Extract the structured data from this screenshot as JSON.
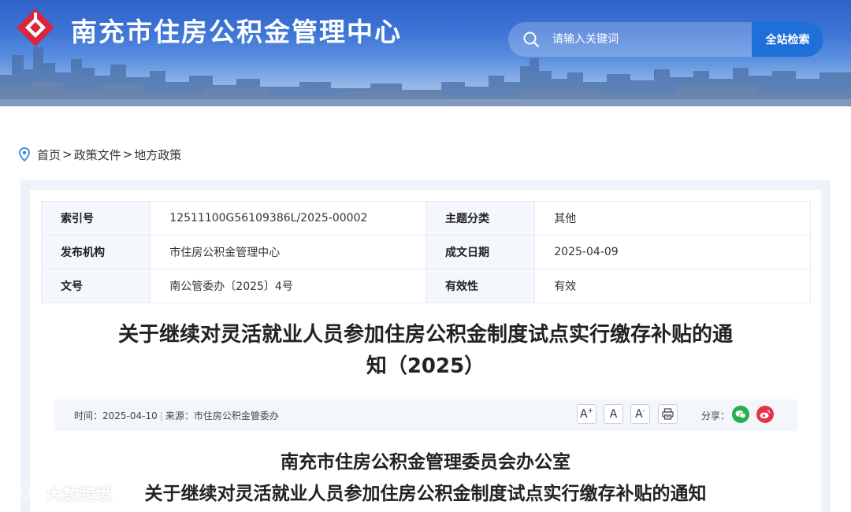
{
  "header": {
    "site_title": "南充市住房公积金管理中心",
    "search_placeholder": "请输入关键词",
    "search_button": "全站检索",
    "logo_icon": "red-diamond-logo-icon"
  },
  "breadcrumb": {
    "icon": "location-pin-icon",
    "items": [
      "首页",
      "政策文件",
      "地方政策"
    ],
    "separator": ">"
  },
  "info_table": {
    "rows": [
      {
        "label1": "索引号",
        "value1": "12511100G56109386L/2025-00002",
        "label2": "主题分类",
        "value2": "其他"
      },
      {
        "label1": "发布机构",
        "value1": "市住房公积金管理中心",
        "label2": "成文日期",
        "value2": "2025-04-09"
      },
      {
        "label1": "文号",
        "value1": "南公管委办〔2025〕4号",
        "label2": "有效性",
        "value2": "有效"
      }
    ]
  },
  "article": {
    "title_line1": "关于继续对灵活就业人员参加住房公积金制度试点实行缴存补贴的通",
    "title_line2": "知（2025）",
    "meta_time_label": "时间：",
    "meta_time": "2025-04-10",
    "meta_source_label": "来源：",
    "meta_source": "市住房公积金管委办",
    "meta_sep": "|",
    "share_label": "分享：",
    "body_heading1": "南充市住房公积金管理委员会办公室",
    "body_heading2": "关于继续对灵活就业人员参加住房公积金制度试点实行缴存补贴的通知"
  },
  "tools": {
    "font_increase": "A",
    "font_increase_sup": "+",
    "font_normal": "A",
    "font_decrease": "A",
    "font_decrease_sup": "-"
  },
  "watermark": {
    "text": "大数跨境"
  },
  "colors": {
    "header_blue": "#2f63c9",
    "search_button": "#1e6fd9",
    "logo_red": "#d7263d",
    "wechat_green": "#22b14c",
    "weibo_red": "#e3344b",
    "frame_bg": "#eef2fa"
  }
}
